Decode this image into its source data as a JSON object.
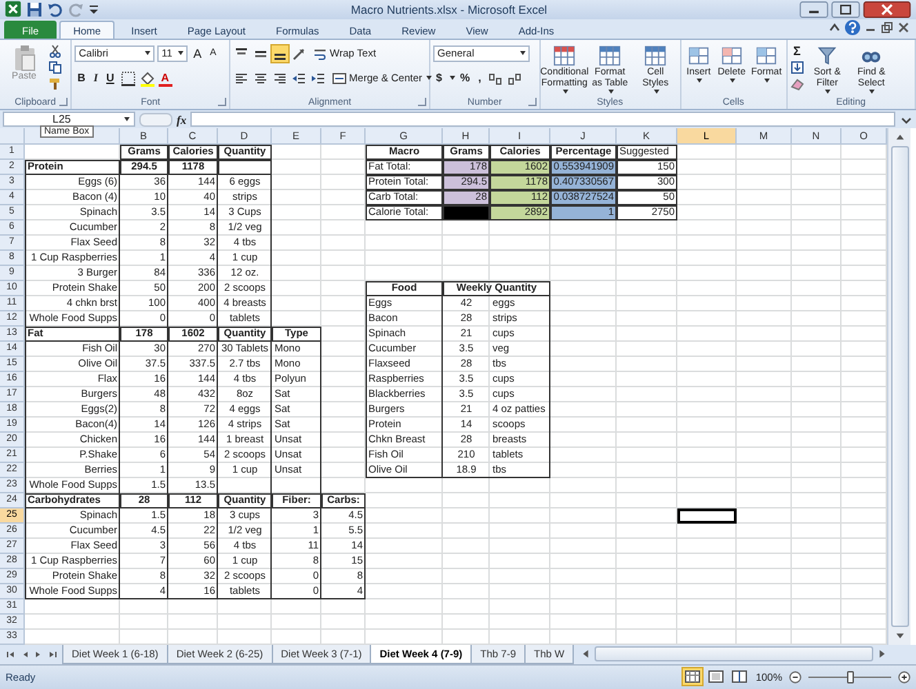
{
  "window": {
    "title": "Macro Nutrients.xlsx - Microsoft Excel"
  },
  "ribbon_tabs": [
    {
      "label": "File",
      "kind": "file",
      "selected": false
    },
    {
      "label": "Home",
      "selected": true
    },
    {
      "label": "Insert",
      "selected": false
    },
    {
      "label": "Page Layout",
      "selected": false
    },
    {
      "label": "Formulas",
      "selected": false
    },
    {
      "label": "Data",
      "selected": false
    },
    {
      "label": "Review",
      "selected": false
    },
    {
      "label": "View",
      "selected": false
    },
    {
      "label": "Add-Ins",
      "selected": false
    }
  ],
  "ribbon": {
    "clipboard": {
      "label": "Clipboard",
      "paste": "Paste"
    },
    "font": {
      "label": "Font",
      "family": "Calibri",
      "size": "11",
      "grow": "A",
      "shrink": "A",
      "bold": "B",
      "italic": "I",
      "underline": "U",
      "color_button": "A"
    },
    "alignment": {
      "label": "Alignment",
      "bottom_align_selected": true,
      "wrap": "Wrap Text",
      "merge": "Merge & Center"
    },
    "number": {
      "label": "Number",
      "format": "General",
      "currency": "$",
      "percent": "%",
      "comma": ","
    },
    "styles": {
      "label": "Styles",
      "buttons": [
        "Conditional Formatting",
        "Format as Table",
        "Cell Styles"
      ]
    },
    "cells": {
      "label": "Cells",
      "buttons": [
        "Insert",
        "Delete",
        "Format"
      ]
    },
    "editing": {
      "label": "Editing",
      "sum": "Σ",
      "buttons": [
        "Sort & Filter",
        "Find & Select"
      ]
    }
  },
  "formula_bar": {
    "name_box": "L25",
    "tooltip": "Name Box",
    "function": "fx"
  },
  "sheet": {
    "columns": [
      {
        "selected": false
      },
      {
        "label": "B",
        "selected": false
      },
      {
        "label": "C",
        "selected": false
      },
      {
        "label": "D",
        "selected": false
      },
      {
        "label": "E",
        "selected": false
      },
      {
        "label": "F",
        "selected": false
      },
      {
        "label": "G",
        "selected": false
      },
      {
        "label": "H",
        "selected": false
      },
      {
        "label": "I",
        "selected": false
      },
      {
        "label": "J",
        "selected": false
      },
      {
        "label": "K",
        "selected": false
      },
      {
        "label": "L",
        "selected": true
      },
      {
        "label": "M",
        "selected": false
      },
      {
        "label": "N",
        "selected": false
      },
      {
        "label": "O",
        "selected": false
      }
    ],
    "rows": [
      {
        "number": "1",
        "selected": false,
        "cells": [
          null,
          {
            "text": "Grams",
            "kind": "head"
          },
          {
            "text": "Calories",
            "kind": "head"
          },
          {
            "text": "Quantity",
            "kind": "head"
          },
          null,
          null,
          {
            "text": "Macro",
            "kind": "head"
          },
          {
            "text": "Grams",
            "kind": "head"
          },
          {
            "text": "Calories",
            "kind": "head"
          },
          {
            "text": "Percentage",
            "kind": "head"
          },
          {
            "text": "Suggested",
            "kind": "box"
          }
        ]
      },
      {
        "number": "2",
        "selected": false,
        "cells": [
          {
            "text": "Protein",
            "kind": "head_left"
          },
          {
            "text": "294.5",
            "kind": "head"
          },
          {
            "text": "1178",
            "kind": "head"
          },
          {
            "kind": "head"
          },
          null,
          null,
          {
            "text": "Fat Total:",
            "kind": "box"
          },
          {
            "text": "178",
            "kind": "box_num",
            "color": "#ccc0da"
          },
          {
            "text": "1602",
            "kind": "box_num",
            "color": "#c4d79b"
          },
          {
            "text": "0.553941909",
            "kind": "box_num",
            "color": "#95b3d7"
          },
          {
            "text": "150",
            "kind": "box_num"
          }
        ]
      },
      {
        "number": "3",
        "selected": false,
        "cells": [
          {
            "text": "Eggs (6)",
            "kind": "label"
          },
          {
            "text": "36",
            "kind": "num"
          },
          {
            "text": "144",
            "kind": "num"
          },
          {
            "text": "6 eggs",
            "kind": "qty"
          },
          null,
          null,
          {
            "text": "Protein Total:",
            "kind": "box"
          },
          {
            "text": "294.5",
            "kind": "box_num",
            "color": "#ccc0da"
          },
          {
            "text": "1178",
            "kind": "box_num",
            "color": "#c4d79b"
          },
          {
            "text": "0.407330567",
            "kind": "box_num",
            "color": "#95b3d7"
          },
          {
            "text": "300",
            "kind": "box_num"
          }
        ]
      },
      {
        "number": "4",
        "selected": false,
        "cells": [
          {
            "text": "Bacon (4)",
            "kind": "label"
          },
          {
            "text": "10",
            "kind": "num"
          },
          {
            "text": "40",
            "kind": "num"
          },
          {
            "text": "strips",
            "kind": "qty"
          },
          null,
          null,
          {
            "text": "Carb Total:",
            "kind": "box"
          },
          {
            "text": "28",
            "kind": "box_num",
            "color": "#ccc0da"
          },
          {
            "text": "112",
            "kind": "box_num",
            "color": "#c4d79b"
          },
          {
            "text": "0.038727524",
            "kind": "box_num",
            "color": "#95b3d7"
          },
          {
            "text": "50",
            "kind": "box_num"
          }
        ]
      },
      {
        "number": "5",
        "selected": false,
        "cells": [
          {
            "text": "Spinach",
            "kind": "label"
          },
          {
            "text": "3.5",
            "kind": "num"
          },
          {
            "text": "14",
            "kind": "num"
          },
          {
            "text": "3 Cups",
            "kind": "qty"
          },
          null,
          null,
          {
            "text": "Calorie Total:",
            "kind": "box"
          },
          {
            "kind": "box_num",
            "color": "#000000"
          },
          {
            "text": "2892",
            "kind": "box_num",
            "color": "#c4d79b"
          },
          {
            "text": "1",
            "kind": "box_num",
            "color": "#95b3d7"
          },
          {
            "text": "2750",
            "kind": "box_num"
          }
        ]
      },
      {
        "number": "6",
        "selected": false,
        "cells": [
          {
            "text": "Cucumber",
            "kind": "label"
          },
          {
            "text": "2",
            "kind": "num"
          },
          {
            "text": "8",
            "kind": "num"
          },
          {
            "text": "1/2 veg",
            "kind": "qty"
          }
        ]
      },
      {
        "number": "7",
        "selected": false,
        "cells": [
          {
            "text": "Flax Seed",
            "kind": "label"
          },
          {
            "text": "8",
            "kind": "num"
          },
          {
            "text": "32",
            "kind": "num"
          },
          {
            "text": "4 tbs",
            "kind": "qty"
          }
        ]
      },
      {
        "number": "8",
        "selected": false,
        "cells": [
          {
            "text": "1 Cup Raspberries",
            "kind": "label"
          },
          {
            "text": "1",
            "kind": "num"
          },
          {
            "text": "4",
            "kind": "num"
          },
          {
            "text": "1 cup",
            "kind": "qty"
          }
        ]
      },
      {
        "number": "9",
        "selected": false,
        "cells": [
          {
            "text": "3 Burger",
            "kind": "label"
          },
          {
            "text": "84",
            "kind": "num"
          },
          {
            "text": "336",
            "kind": "num"
          },
          {
            "text": "12 oz.",
            "kind": "qty"
          }
        ]
      },
      {
        "number": "10",
        "selected": false,
        "cells": [
          {
            "text": "Protein Shake",
            "kind": "label"
          },
          {
            "text": "50",
            "kind": "num"
          },
          {
            "text": "200",
            "kind": "num"
          },
          {
            "text": "2 scoops",
            "kind": "qty"
          },
          null,
          null,
          {
            "text": "Food",
            "kind": "head"
          },
          {
            "text": "Weekly Quantity",
            "kind": "head",
            "merged": true
          }
        ]
      },
      {
        "number": "11",
        "selected": false,
        "cells": [
          {
            "text": "4 chkn brst",
            "kind": "label"
          },
          {
            "text": "100",
            "kind": "num"
          },
          {
            "text": "400",
            "kind": "num"
          },
          {
            "text": "4 breasts",
            "kind": "qty"
          },
          null,
          null,
          {
            "text": "Eggs",
            "kind": "food"
          },
          {
            "text": "42",
            "kind": "food_num"
          },
          {
            "text": "eggs",
            "kind": "food_unit"
          }
        ]
      },
      {
        "number": "12",
        "selected": false,
        "cells": [
          {
            "text": "Whole Food Supps",
            "kind": "label"
          },
          {
            "text": "0",
            "kind": "num"
          },
          {
            "text": "0",
            "kind": "num"
          },
          {
            "text": "tablets",
            "kind": "qty"
          },
          null,
          null,
          {
            "text": "Bacon",
            "kind": "food"
          },
          {
            "text": "28",
            "kind": "food_num"
          },
          {
            "text": "strips",
            "kind": "food_unit"
          }
        ]
      },
      {
        "number": "13",
        "selected": false,
        "cells": [
          {
            "text": "Fat",
            "kind": "head_left"
          },
          {
            "text": "178",
            "kind": "head"
          },
          {
            "text": "1602",
            "kind": "head"
          },
          {
            "text": "Quantity",
            "kind": "head"
          },
          {
            "text": "Type",
            "kind": "head"
          },
          null,
          {
            "text": "Spinach",
            "kind": "food"
          },
          {
            "text": "21",
            "kind": "food_num"
          },
          {
            "text": "cups",
            "kind": "food_unit"
          }
        ]
      },
      {
        "number": "14",
        "selected": false,
        "cells": [
          {
            "text": "Fish Oil",
            "kind": "label"
          },
          {
            "text": "30",
            "kind": "num"
          },
          {
            "text": "270",
            "kind": "num"
          },
          {
            "text": "30 Tablets",
            "kind": "qty"
          },
          {
            "text": "Mono",
            "kind": "type"
          },
          null,
          {
            "text": "Cucumber",
            "kind": "food"
          },
          {
            "text": "3.5",
            "kind": "food_num"
          },
          {
            "text": "veg",
            "kind": "food_unit"
          }
        ]
      },
      {
        "number": "15",
        "selected": false,
        "cells": [
          {
            "text": "Olive Oil",
            "kind": "label"
          },
          {
            "text": "37.5",
            "kind": "num"
          },
          {
            "text": "337.5",
            "kind": "num"
          },
          {
            "text": "2.7 tbs",
            "kind": "qty"
          },
          {
            "text": "Mono",
            "kind": "type"
          },
          null,
          {
            "text": "Flaxseed",
            "kind": "food"
          },
          {
            "text": "28",
            "kind": "food_num"
          },
          {
            "text": "tbs",
            "kind": "food_unit"
          }
        ]
      },
      {
        "number": "16",
        "selected": false,
        "cells": [
          {
            "text": "Flax",
            "kind": "label"
          },
          {
            "text": "16",
            "kind": "num"
          },
          {
            "text": "144",
            "kind": "num"
          },
          {
            "text": "4 tbs",
            "kind": "qty"
          },
          {
            "text": "Polyun",
            "kind": "type"
          },
          null,
          {
            "text": "Raspberries",
            "kind": "food"
          },
          {
            "text": "3.5",
            "kind": "food_num"
          },
          {
            "text": "cups",
            "kind": "food_unit"
          }
        ]
      },
      {
        "number": "17",
        "selected": false,
        "cells": [
          {
            "text": "Burgers",
            "kind": "label"
          },
          {
            "text": "48",
            "kind": "num"
          },
          {
            "text": "432",
            "kind": "num"
          },
          {
            "text": "8oz",
            "kind": "qty"
          },
          {
            "text": "Sat",
            "kind": "type"
          },
          null,
          {
            "text": "Blackberries",
            "kind": "food"
          },
          {
            "text": "3.5",
            "kind": "food_num"
          },
          {
            "text": "cups",
            "kind": "food_unit"
          }
        ]
      },
      {
        "number": "18",
        "selected": false,
        "cells": [
          {
            "text": "Eggs(2)",
            "kind": "label"
          },
          {
            "text": "8",
            "kind": "num"
          },
          {
            "text": "72",
            "kind": "num"
          },
          {
            "text": "4 eggs",
            "kind": "qty"
          },
          {
            "text": "Sat",
            "kind": "type"
          },
          null,
          {
            "text": "Burgers",
            "kind": "food"
          },
          {
            "text": "21",
            "kind": "food_num"
          },
          {
            "text": "4 oz patties",
            "kind": "food_unit"
          }
        ]
      },
      {
        "number": "19",
        "selected": false,
        "cells": [
          {
            "text": "Bacon(4)",
            "kind": "label"
          },
          {
            "text": "14",
            "kind": "num"
          },
          {
            "text": "126",
            "kind": "num"
          },
          {
            "text": "4 strips",
            "kind": "qty"
          },
          {
            "text": "Sat",
            "kind": "type"
          },
          null,
          {
            "text": "Protein",
            "kind": "food"
          },
          {
            "text": "14",
            "kind": "food_num"
          },
          {
            "text": "scoops",
            "kind": "food_unit"
          }
        ]
      },
      {
        "number": "20",
        "selected": false,
        "cells": [
          {
            "text": "Chicken",
            "kind": "label"
          },
          {
            "text": "16",
            "kind": "num"
          },
          {
            "text": "144",
            "kind": "num"
          },
          {
            "text": "1 breast",
            "kind": "qty"
          },
          {
            "text": "Unsat",
            "kind": "type"
          },
          null,
          {
            "text": "Chkn Breast",
            "kind": "food"
          },
          {
            "text": "28",
            "kind": "food_num"
          },
          {
            "text": "breasts",
            "kind": "food_unit"
          }
        ]
      },
      {
        "number": "21",
        "selected": false,
        "cells": [
          {
            "text": "P.Shake",
            "kind": "label"
          },
          {
            "text": "6",
            "kind": "num"
          },
          {
            "text": "54",
            "kind": "num"
          },
          {
            "text": "2 scoops",
            "kind": "qty"
          },
          {
            "text": "Unsat",
            "kind": "type"
          },
          null,
          {
            "text": "Fish Oil",
            "kind": "food"
          },
          {
            "text": "210",
            "kind": "food_num"
          },
          {
            "text": "tablets",
            "kind": "food_unit"
          }
        ]
      },
      {
        "number": "22",
        "selected": false,
        "cells": [
          {
            "text": "Berries",
            "kind": "label"
          },
          {
            "text": "1",
            "kind": "num"
          },
          {
            "text": "9",
            "kind": "num"
          },
          {
            "text": "1 cup",
            "kind": "qty"
          },
          {
            "text": "Unsat",
            "kind": "type"
          },
          null,
          {
            "text": "Olive Oil",
            "kind": "food",
            "last": true
          },
          {
            "text": "18.9",
            "kind": "food_num",
            "last": true
          },
          {
            "text": "tbs",
            "kind": "food_unit",
            "last": true
          }
        ]
      },
      {
        "number": "23",
        "selected": false,
        "cells": [
          {
            "text": "Whole Food Supps",
            "kind": "label"
          },
          {
            "text": "1.5",
            "kind": "num"
          },
          {
            "text": "13.5",
            "kind": "num"
          },
          {
            "kind": "qty"
          },
          {
            "kind": "type"
          }
        ]
      },
      {
        "number": "24",
        "selected": false,
        "cells": [
          {
            "text": "Carbohydrates",
            "kind": "head_left"
          },
          {
            "text": "28",
            "kind": "head"
          },
          {
            "text": "112",
            "kind": "head"
          },
          {
            "text": "Quantity",
            "kind": "head"
          },
          {
            "text": "Fiber:",
            "kind": "head"
          },
          {
            "text": "Carbs:",
            "kind": "head"
          }
        ]
      },
      {
        "number": "25",
        "selected": true,
        "cells": [
          {
            "text": "Spinach",
            "kind": "label"
          },
          {
            "text": "1.5",
            "kind": "num"
          },
          {
            "text": "18",
            "kind": "num"
          },
          {
            "text": "3 cups",
            "kind": "qty"
          },
          {
            "text": "3",
            "kind": "num"
          },
          {
            "text": "4.5",
            "kind": "num"
          }
        ]
      },
      {
        "number": "26",
        "selected": false,
        "cells": [
          {
            "text": "Cucumber",
            "kind": "label"
          },
          {
            "text": "4.5",
            "kind": "num"
          },
          {
            "text": "22",
            "kind": "num"
          },
          {
            "text": "1/2 veg",
            "kind": "qty"
          },
          {
            "text": "1",
            "kind": "num"
          },
          {
            "text": "5.5",
            "kind": "num"
          }
        ]
      },
      {
        "number": "27",
        "selected": false,
        "cells": [
          {
            "text": "Flax Seed",
            "kind": "label"
          },
          {
            "text": "3",
            "kind": "num"
          },
          {
            "text": "56",
            "kind": "num"
          },
          {
            "text": "4 tbs",
            "kind": "qty"
          },
          {
            "text": "11",
            "kind": "num"
          },
          {
            "text": "14",
            "kind": "num"
          }
        ]
      },
      {
        "number": "28",
        "selected": false,
        "cells": [
          {
            "text": "1 Cup Raspberries",
            "kind": "label"
          },
          {
            "text": "7",
            "kind": "num"
          },
          {
            "text": "60",
            "kind": "num"
          },
          {
            "text": "1 cup",
            "kind": "qty"
          },
          {
            "text": "8",
            "kind": "num"
          },
          {
            "text": "15",
            "kind": "num"
          }
        ]
      },
      {
        "number": "29",
        "selected": false,
        "cells": [
          {
            "text": "Protein Shake",
            "kind": "label"
          },
          {
            "text": "8",
            "kind": "num"
          },
          {
            "text": "32",
            "kind": "num"
          },
          {
            "text": "2 scoops",
            "kind": "qty"
          },
          {
            "text": "0",
            "kind": "num"
          },
          {
            "text": "8",
            "kind": "num"
          }
        ]
      },
      {
        "number": "30",
        "selected": false,
        "cells": [
          {
            "text": "Whole Food Supps",
            "kind": "label",
            "last": true
          },
          {
            "text": "4",
            "kind": "num",
            "last": true
          },
          {
            "text": "16",
            "kind": "num",
            "last": true
          },
          {
            "text": "tablets",
            "kind": "qty",
            "last": true
          },
          {
            "text": "0",
            "kind": "num",
            "last": true
          },
          {
            "text": "4",
            "kind": "num",
            "last": true
          }
        ]
      },
      {
        "number": "31",
        "selected": false
      },
      {
        "number": "32",
        "selected": false
      },
      {
        "number": "33",
        "selected": false
      }
    ]
  },
  "sheet_tabs": [
    {
      "label": "Diet Week 1 (6-18)",
      "selected": false
    },
    {
      "label": "Diet Week 2 (6-25)",
      "selected": false
    },
    {
      "label": "Diet Week 3 (7-1)",
      "selected": false
    },
    {
      "label": "Diet Week 4 (7-9)",
      "selected": true
    },
    {
      "label": "Thb 7-9",
      "selected": false
    },
    {
      "label": "Thb W",
      "selected": false
    }
  ],
  "status_bar": {
    "status": "Ready",
    "zoom": "100%",
    "zoom_slider": {
      "level": 0.5
    }
  }
}
